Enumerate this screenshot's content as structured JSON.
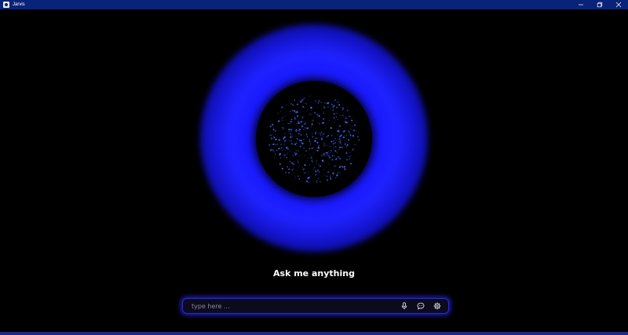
{
  "window": {
    "title": "Jarvis",
    "app_icon": "jarvis-app-icon",
    "controls": [
      "minimize-icon",
      "restore-icon",
      "close-icon"
    ]
  },
  "orb": {
    "glow_color": "#1a1aff",
    "core_color": "#000000",
    "particle_color": "#3a6cff"
  },
  "main": {
    "prompt": "Ask me anything"
  },
  "input": {
    "placeholder": "type here ...",
    "value": "",
    "buttons": [
      "microphone-icon",
      "chat-icon",
      "settings-icon"
    ],
    "accent": "#2a2acc"
  },
  "colors": {
    "titlebar": "#0a237a",
    "background": "#000000"
  }
}
